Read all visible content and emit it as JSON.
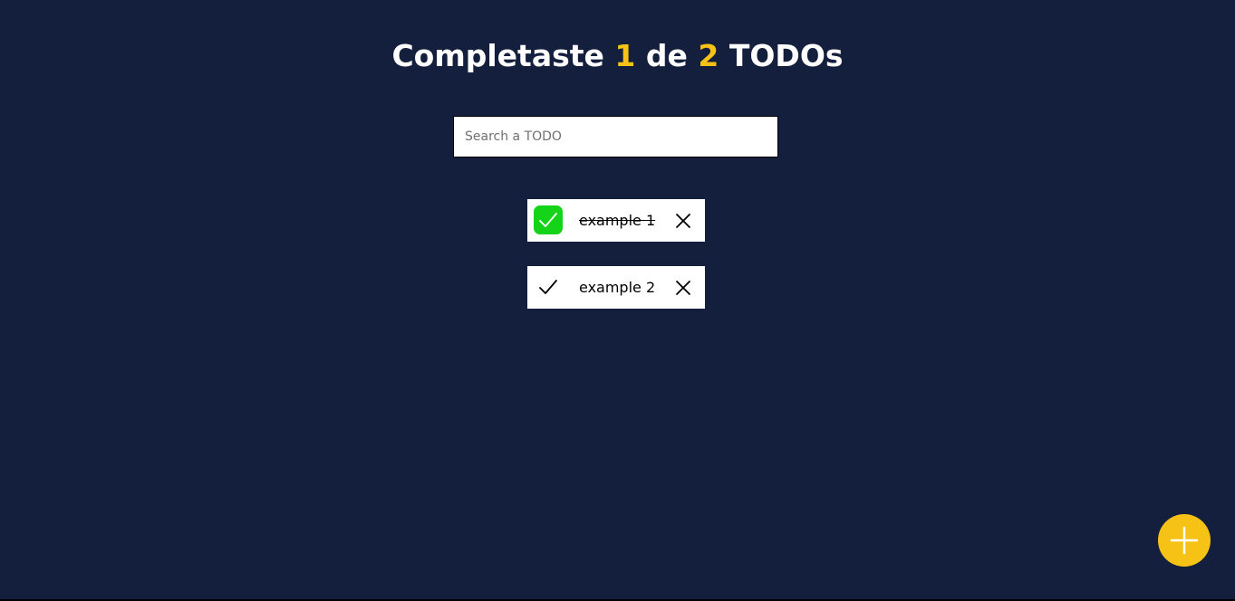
{
  "counter": {
    "prefix": "Completaste",
    "completed": "1",
    "middle": "de",
    "total": "2",
    "suffix": "TODOs"
  },
  "search": {
    "placeholder": "Search a TODO",
    "value": ""
  },
  "todos": [
    {
      "text": "example 1",
      "completed": true
    },
    {
      "text": "example 2",
      "completed": false
    }
  ],
  "colors": {
    "background": "#131f3d",
    "accent": "#f6c216",
    "check_active": "#15d319"
  },
  "icons": {
    "check": "check-icon",
    "delete": "close-icon",
    "add": "plus-icon"
  }
}
